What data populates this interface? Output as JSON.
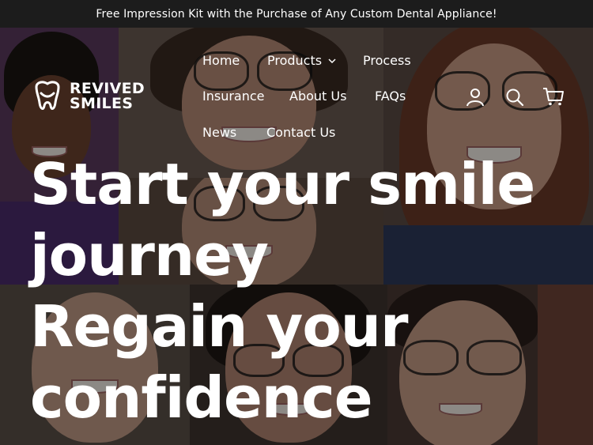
{
  "announcement": {
    "text": "Free Impression Kit with the Purchase of Any Custom Dental Appliance!"
  },
  "brand": {
    "name_line1": "REVIVED",
    "name_line2": "SMILES",
    "logo_icon": "tooth-icon"
  },
  "nav": {
    "items": [
      {
        "label": "Home"
      },
      {
        "label": "Products"
      },
      {
        "label": "Process"
      },
      {
        "label": "Insurance"
      },
      {
        "label": "About Us"
      },
      {
        "label": "FAQs"
      },
      {
        "label": "News"
      },
      {
        "label": "Contact Us"
      }
    ]
  },
  "header_icons": {
    "account": "account-icon",
    "search": "search-icon",
    "cart": "cart-icon"
  },
  "hero": {
    "line1": "Start your smile",
    "line2": "journey",
    "line3": "Regain your",
    "line4": "confidence"
  }
}
